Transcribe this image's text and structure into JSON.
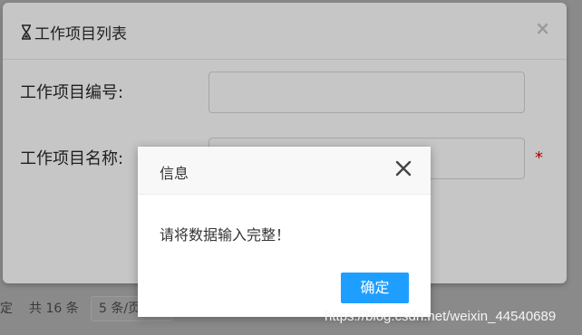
{
  "outer_dialog": {
    "title": "工作项目列表",
    "fields": {
      "code_label": "工作项目编号:",
      "code_value": "",
      "name_label": "工作项目名称:",
      "name_value": "",
      "required_mark": "*"
    }
  },
  "info_dialog": {
    "title": "信息",
    "message": "请将数据输入完整！",
    "ok_label": "确定"
  },
  "pager": {
    "left_fragment": "定",
    "total_text": "共 16 条",
    "page_size_text": "5 条/页"
  },
  "watermark": "https://blog.csdn.net/weixin_44540689"
}
